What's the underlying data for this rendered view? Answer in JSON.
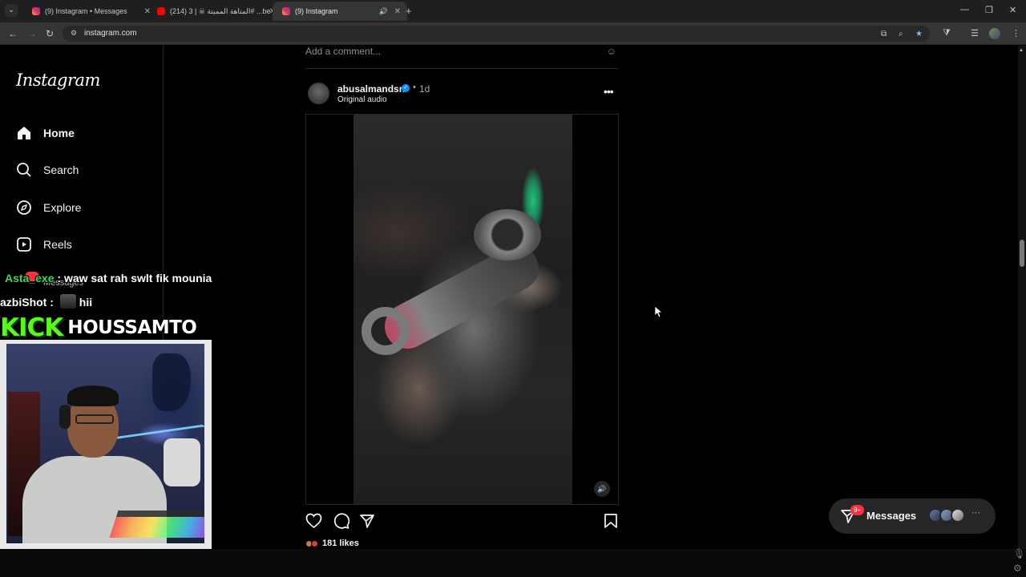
{
  "browser": {
    "tabs": [
      {
        "title": "(9) Instagram • Messages",
        "favicon": "instagram-icon",
        "active": false
      },
      {
        "title": "(214) المتاهة المميتة ☠ | 3# ...be",
        "favicon": "youtube-icon",
        "active": false
      },
      {
        "title": "(9) Instagram",
        "favicon": "instagram-icon",
        "active": true
      }
    ],
    "url": "instagram.com"
  },
  "sidebar": {
    "logo": "Instagram",
    "items": [
      {
        "label": "Home",
        "icon": "home-icon"
      },
      {
        "label": "Search",
        "icon": "search-icon"
      },
      {
        "label": "Explore",
        "icon": "compass-icon"
      },
      {
        "label": "Reels",
        "icon": "reels-icon"
      },
      {
        "label": "Messages",
        "icon": "messages-icon"
      }
    ]
  },
  "feed": {
    "comment_placeholder": "Add a comment...",
    "post": {
      "username": "abusalmandsn",
      "separator": "•",
      "time": "1d",
      "audio": "Original audio",
      "likes": "181 likes"
    }
  },
  "messages_pill": {
    "badge": "9+",
    "label": "Messages"
  },
  "overlay": {
    "chat": [
      {
        "user": "Asta_exe",
        "text": " : waw sat rah swlt fik mounia"
      },
      {
        "user": "azbiShot",
        "text": " : ",
        "emote": true,
        "after": "hii"
      }
    ],
    "kick_logo": "KICK",
    "streamer": "HOUSSAMTO"
  },
  "colors": {
    "accent_blue": "#0095f6",
    "notification_red": "#ff3040",
    "kick_green": "#53fc18"
  }
}
